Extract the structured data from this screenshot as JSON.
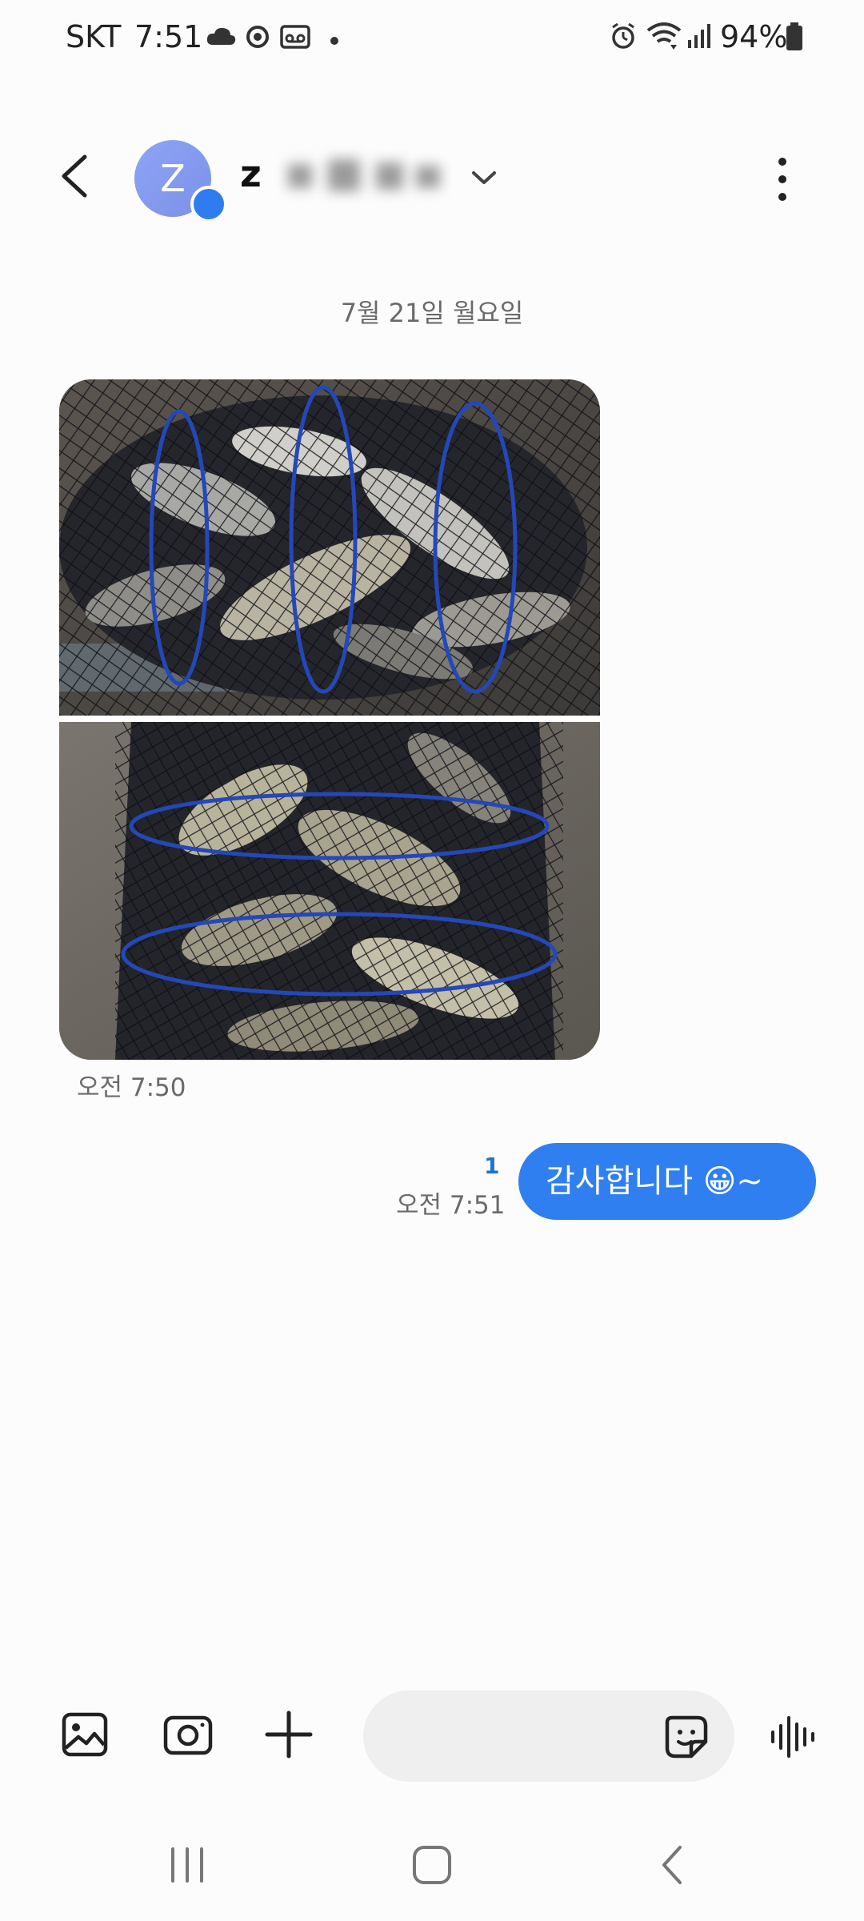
{
  "status_bar": {
    "carrier": "SKT",
    "time": "7:51",
    "battery": "94%"
  },
  "header": {
    "avatar_letter": "Z",
    "contact_name": "z"
  },
  "conversation": {
    "date_divider": "7월 21일 월요일",
    "incoming": {
      "time": "오전 7:50"
    },
    "outgoing": {
      "read_count": "1",
      "time": "오전 7:51",
      "text": "감사합니다 😀~"
    }
  },
  "composer": {
    "placeholder": ""
  },
  "colors": {
    "accent": "#2f7ff0",
    "background": "#fcfcfc"
  }
}
